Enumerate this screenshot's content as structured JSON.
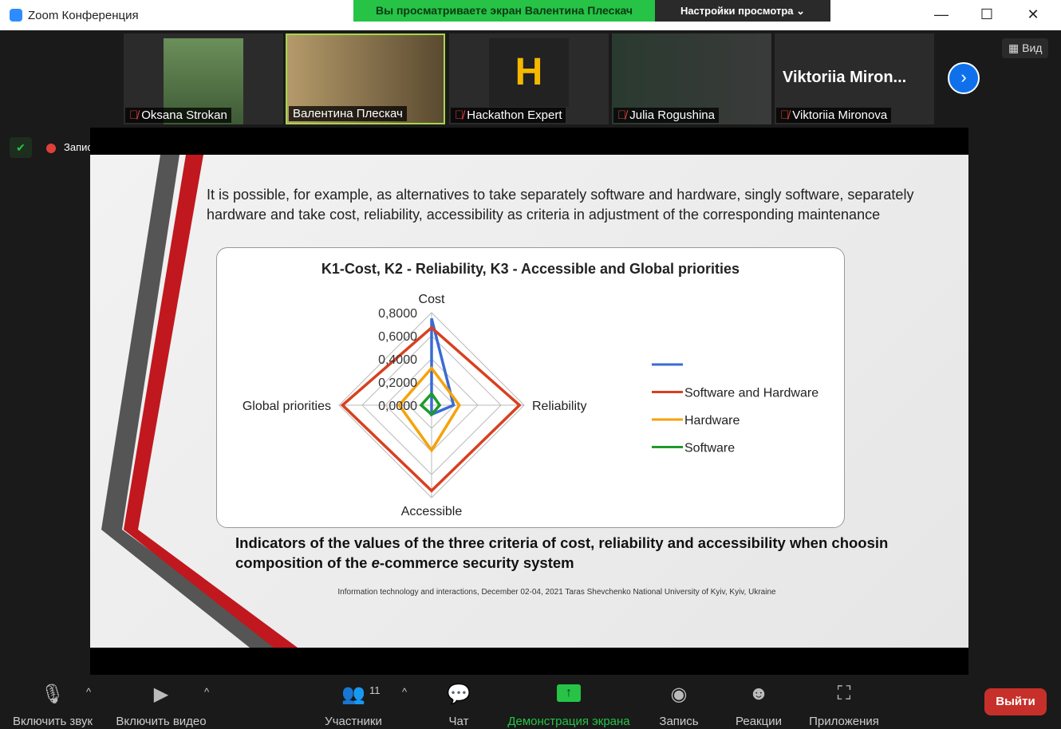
{
  "window": {
    "title": "Zoom Конференция",
    "banner": "Вы просматриваете экран Валентина Плескач",
    "view_settings": "Настройки просмотра ⌄",
    "view_button": "Вид",
    "recording": "Запись"
  },
  "participants": [
    {
      "name": "Oksana Strokan",
      "muted": true
    },
    {
      "name": "Валентина Плескач",
      "muted": false
    },
    {
      "name": "Hackathon Expert",
      "muted": true
    },
    {
      "name": "Julia Rogushina",
      "muted": true
    },
    {
      "name": "Viktoriia Mironova",
      "muted": true,
      "big_label": "Viktoriia  Miron..."
    }
  ],
  "slide": {
    "text": "It is possible, for example, as alternatives to take separately software and hardware, singly software, separately hardware and take cost, reliability, accessibility as criteria in adjustment of the corresponding maintenance",
    "caption_pre": "Indicators of the values of the three criteria of cost, reliability and accessibility when choosin composition of the ",
    "caption_em": "e",
    "caption_post": "-commerce security system",
    "footer": "Information technology and interactions, December 02-04, 2021 Taras Shevchenko National University of Kyiv, Kyiv, Ukraine"
  },
  "chart_data": {
    "type": "radar",
    "title": "K1-Cost, K2 - Reliability, K3 - Accessible and Global priorities",
    "axes": [
      "Cost",
      "Reliability",
      "Accessible",
      "Global priorities"
    ],
    "ticks": [
      "0,0000",
      "0,2000",
      "0,4000",
      "0,6000",
      "0,8000"
    ],
    "range": [
      0,
      0.8
    ],
    "series": [
      {
        "name": "",
        "color": "#3a6bd4",
        "values": [
          0.75,
          0.19,
          0.08,
          0.0
        ]
      },
      {
        "name": "Software and Hardware",
        "color": "#d8401f",
        "values": [
          0.67,
          0.76,
          0.74,
          0.77
        ]
      },
      {
        "name": "Hardware",
        "color": "#f5a20a",
        "values": [
          0.32,
          0.24,
          0.39,
          0.28
        ]
      },
      {
        "name": "Software",
        "color": "#1e9a2a",
        "values": [
          0.1,
          0.07,
          0.08,
          0.09
        ]
      }
    ],
    "legend": "right"
  },
  "toolbar": {
    "unmute": "Включить звук",
    "video": "Включить видео",
    "participants": "Участники",
    "participants_count": "11",
    "chat": "Чат",
    "share": "Демонстрация экрана",
    "record": "Запись",
    "reactions": "Реакции",
    "apps": "Приложения",
    "leave": "Выйти"
  }
}
